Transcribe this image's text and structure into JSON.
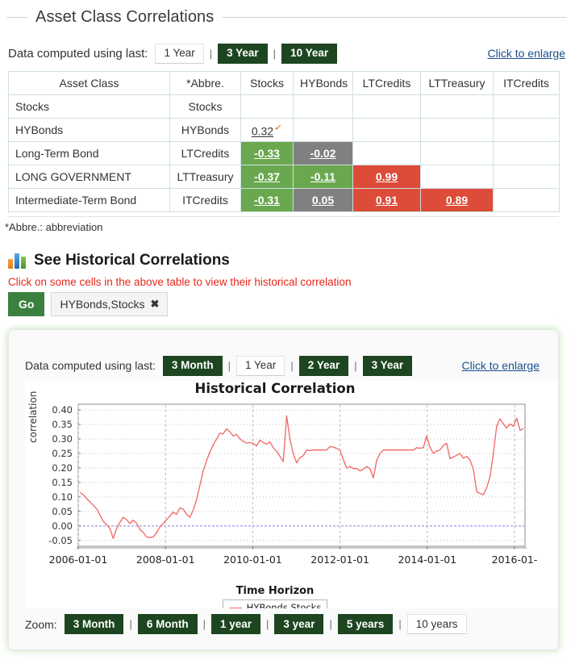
{
  "section": {
    "title": "Asset Class Correlations"
  },
  "toolbar": {
    "label": "Data computed using last:",
    "options": [
      {
        "label": "1 Year",
        "selected": true
      },
      {
        "label": "3 Year",
        "selected": false
      },
      {
        "label": "10 Year",
        "selected": false
      }
    ],
    "enlarge_link": "Click to enlarge",
    "separator": "|"
  },
  "table": {
    "headers": [
      "Asset Class",
      "*Abbre.",
      "Stocks",
      "HYBonds",
      "LTCredits",
      "LTTreasury",
      "ITCredits"
    ],
    "rows": [
      {
        "name": "Stocks",
        "abbr": "Stocks",
        "cells": [
          {
            "value": "",
            "color": "none"
          },
          {
            "value": "",
            "color": "none"
          },
          {
            "value": "",
            "color": "none"
          },
          {
            "value": "",
            "color": "none"
          },
          {
            "value": "",
            "color": "none"
          }
        ]
      },
      {
        "name": "HYBonds",
        "abbr": "HYBonds",
        "cells": [
          {
            "value": "0.32",
            "color": "none",
            "checked": true
          },
          {
            "value": "",
            "color": "none"
          },
          {
            "value": "",
            "color": "none"
          },
          {
            "value": "",
            "color": "none"
          },
          {
            "value": "",
            "color": "none"
          }
        ]
      },
      {
        "name": "Long-Term Bond",
        "abbr": "LTCredits",
        "cells": [
          {
            "value": "-0.33",
            "color": "green"
          },
          {
            "value": "-0.02",
            "color": "gray"
          },
          {
            "value": "",
            "color": "none"
          },
          {
            "value": "",
            "color": "none"
          },
          {
            "value": "",
            "color": "none"
          }
        ]
      },
      {
        "name": "LONG GOVERNMENT",
        "abbr": "LTTreasury",
        "cells": [
          {
            "value": "-0.37",
            "color": "green"
          },
          {
            "value": "-0.11",
            "color": "green"
          },
          {
            "value": "0.99",
            "color": "red"
          },
          {
            "value": "",
            "color": "none"
          },
          {
            "value": "",
            "color": "none"
          }
        ]
      },
      {
        "name": "Intermediate-Term Bond",
        "abbr": "ITCredits",
        "cells": [
          {
            "value": "-0.31",
            "color": "green"
          },
          {
            "value": "0.05",
            "color": "gray"
          },
          {
            "value": "0.91",
            "color": "red"
          },
          {
            "value": "0.89",
            "color": "red"
          },
          {
            "value": "",
            "color": "none"
          }
        ]
      }
    ],
    "footnote": "*Abbre.: abbreviation",
    "colors": {
      "green": "#6aa84f",
      "gray": "#808080",
      "red": "#dd4b39",
      "check": "#d96a1a"
    }
  },
  "historical": {
    "icon": "bar-chart-icon",
    "heading": "See Historical Correlations",
    "hint": "Click on some cells in the above table to view their historical correlation",
    "go_label": "Go",
    "tag_label": "HYBonds,Stocks",
    "tag_remove": "✖"
  },
  "panel": {
    "toolbar_label": "Data computed using last:",
    "options": [
      {
        "label": "3 Month",
        "selected": false
      },
      {
        "label": "1 Year",
        "selected": true
      },
      {
        "label": "2 Year",
        "selected": false
      },
      {
        "label": "3 Year",
        "selected": false
      }
    ],
    "enlarge_link": "Click to enlarge",
    "separator": "|",
    "zoom_label": "Zoom:",
    "zoom_options": [
      {
        "label": "3 Month",
        "selected": false
      },
      {
        "label": "6 Month",
        "selected": false
      },
      {
        "label": "1 year",
        "selected": false
      },
      {
        "label": "3 year",
        "selected": false
      },
      {
        "label": "5 years",
        "selected": false
      },
      {
        "label": "10 years",
        "selected": true
      }
    ]
  },
  "chart_data": {
    "type": "line",
    "title": "Historical  Correlation",
    "xlabel": "Time Horizon",
    "ylabel": "correlation",
    "legend": [
      "HYBonds,Stocks"
    ],
    "legend_position": "bottom-center",
    "grid": true,
    "line_color": "#f26d6d",
    "zero_line_color": "#6a6adb",
    "ylim": [
      -0.07,
      0.42
    ],
    "yticks": [
      -0.05,
      0.0,
      0.05,
      0.1,
      0.15,
      0.2,
      0.25,
      0.3,
      0.35,
      0.4
    ],
    "ytick_labels": [
      "-0.05",
      "0.00",
      "0.05",
      "0.10",
      "0.15",
      "0.20",
      "0.25",
      "0.30",
      "0.35",
      "0.40"
    ],
    "xticks": [
      "2006-01-01",
      "2008-01-01",
      "2010-01-01",
      "2012-01-01",
      "2014-01-01",
      "2016-01-"
    ],
    "xlim": [
      "2005-09-01",
      "2016-02-15"
    ],
    "series": [
      {
        "name": "HYBonds,Stocks",
        "x": [
          "2005-10",
          "2005-11",
          "2005-12",
          "2006-01",
          "2006-02",
          "2006-03",
          "2006-04",
          "2006-05",
          "2006-06",
          "2006-07",
          "2006-08",
          "2006-09",
          "2006-10",
          "2006-11",
          "2006-12",
          "2007-01",
          "2007-02",
          "2007-03",
          "2007-04",
          "2007-05",
          "2007-06",
          "2007-07",
          "2007-08",
          "2007-09",
          "2007-10",
          "2007-11",
          "2007-12",
          "2008-01",
          "2008-02",
          "2008-03",
          "2008-04",
          "2008-05",
          "2008-06",
          "2008-07",
          "2008-08",
          "2008-09",
          "2008-10",
          "2008-11",
          "2008-12",
          "2009-01",
          "2009-02",
          "2009-03",
          "2009-04",
          "2009-05",
          "2009-06",
          "2009-07",
          "2009-08",
          "2009-09",
          "2009-10",
          "2009-11",
          "2009-12",
          "2010-01",
          "2010-02",
          "2010-03",
          "2010-04",
          "2010-05",
          "2010-06",
          "2010-07",
          "2010-08",
          "2010-09",
          "2010-10",
          "2010-11",
          "2010-12",
          "2011-01",
          "2011-02",
          "2011-03",
          "2011-04",
          "2011-05",
          "2011-06",
          "2011-07",
          "2011-08",
          "2011-09",
          "2011-10",
          "2011-11",
          "2011-12",
          "2012-01",
          "2012-02",
          "2012-03",
          "2012-04",
          "2012-05",
          "2012-06",
          "2012-07",
          "2012-08",
          "2012-09",
          "2012-10",
          "2012-11",
          "2012-12",
          "2013-01",
          "2013-02",
          "2013-03",
          "2013-04",
          "2013-05",
          "2013-06",
          "2013-07",
          "2013-08",
          "2013-09",
          "2013-10",
          "2013-11",
          "2013-12",
          "2014-01",
          "2014-02",
          "2014-03",
          "2014-04",
          "2014-05",
          "2014-06",
          "2014-07",
          "2014-08",
          "2014-09",
          "2014-10",
          "2014-11",
          "2014-12",
          "2015-01",
          "2015-02",
          "2015-03",
          "2015-04",
          "2015-05",
          "2015-06",
          "2015-07",
          "2015-08",
          "2015-09",
          "2015-10",
          "2015-11",
          "2015-12",
          "2016-01"
        ],
        "values": [
          0.115,
          0.108,
          0.095,
          0.083,
          0.072,
          0.06,
          0.038,
          0.016,
          0.005,
          -0.008,
          -0.043,
          -0.01,
          0.012,
          0.03,
          0.022,
          0.008,
          0.02,
          0.01,
          -0.012,
          -0.022,
          -0.038,
          -0.04,
          -0.038,
          -0.024,
          -0.003,
          0.008,
          0.022,
          0.034,
          0.048,
          0.04,
          0.062,
          0.058,
          0.04,
          0.03,
          0.055,
          0.09,
          0.14,
          0.19,
          0.225,
          0.255,
          0.28,
          0.3,
          0.32,
          0.318,
          0.335,
          0.325,
          0.31,
          0.316,
          0.3,
          0.292,
          0.286,
          0.288,
          0.285,
          0.276,
          0.296,
          0.288,
          0.282,
          0.29,
          0.27,
          0.258,
          0.24,
          0.222,
          0.38,
          0.3,
          0.25,
          0.218,
          0.236,
          0.242,
          0.262,
          0.26,
          0.262,
          0.262,
          0.262,
          0.262,
          0.262,
          0.274,
          0.272,
          0.268,
          0.262,
          0.23,
          0.2,
          0.205,
          0.198,
          0.198,
          0.19,
          0.196,
          0.205,
          0.198,
          0.166,
          0.226,
          0.25,
          0.262,
          0.262,
          0.262,
          0.262,
          0.262,
          0.262,
          0.262,
          0.262,
          0.262,
          0.262,
          0.27,
          0.268,
          0.27,
          0.31,
          0.272,
          0.25,
          0.258,
          0.262,
          0.278,
          0.285,
          0.232,
          0.238,
          0.244,
          0.25,
          0.234,
          0.24,
          0.228,
          0.196,
          0.118,
          0.112,
          0.108,
          0.132,
          0.17,
          0.25,
          0.345,
          0.37,
          0.352,
          0.338,
          0.352,
          0.344,
          0.372,
          0.33,
          0.336
        ]
      }
    ]
  }
}
